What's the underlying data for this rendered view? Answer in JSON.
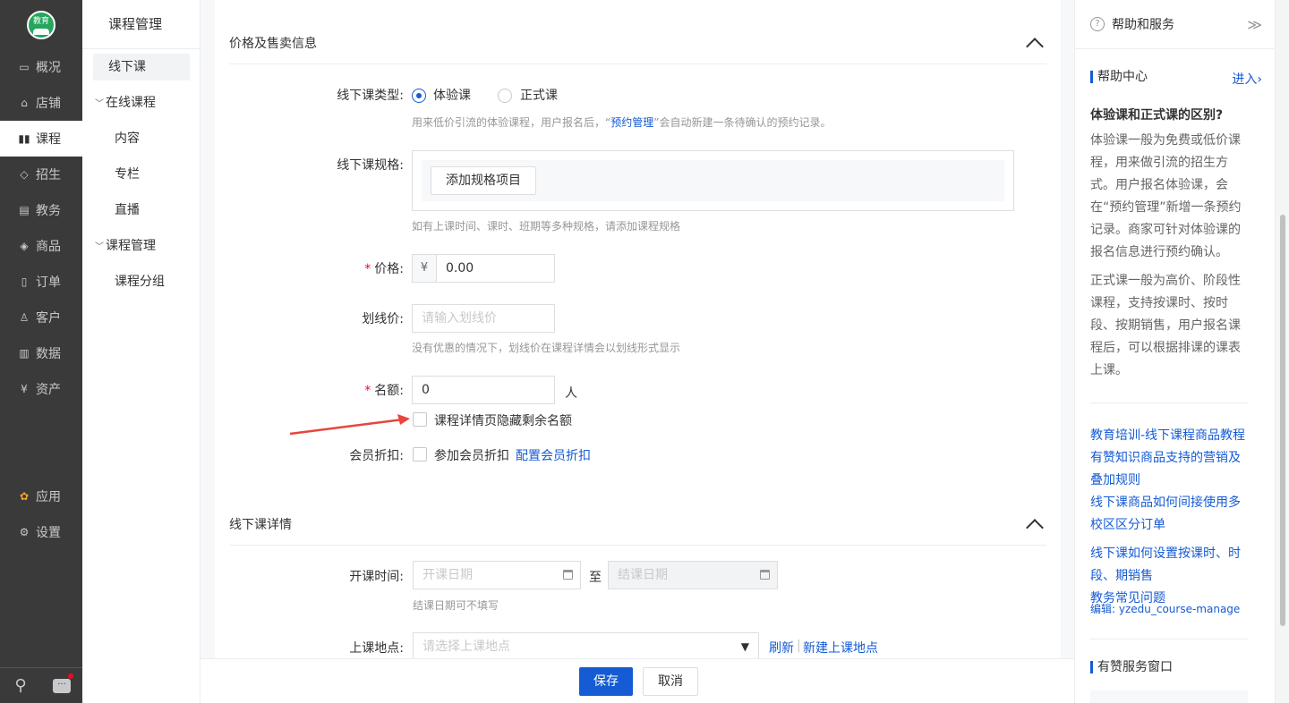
{
  "nav": {
    "logo_text": "教育",
    "items": [
      {
        "label": "概况",
        "icon": "monitor-icon"
      },
      {
        "label": "店铺",
        "icon": "store-icon"
      },
      {
        "label": "课程",
        "icon": "book-icon"
      },
      {
        "label": "招生",
        "icon": "graduation-cap-icon"
      },
      {
        "label": "教务",
        "icon": "calendar-icon"
      },
      {
        "label": "商品",
        "icon": "tag-icon"
      },
      {
        "label": "订单",
        "icon": "document-icon"
      },
      {
        "label": "客户",
        "icon": "user-icon"
      },
      {
        "label": "数据",
        "icon": "bar-chart-icon"
      },
      {
        "label": "资产",
        "icon": "yen-icon"
      },
      {
        "label": "应用",
        "icon": "apps-icon"
      },
      {
        "label": "设置",
        "icon": "gear-icon"
      }
    ],
    "active": "课程"
  },
  "subnav": {
    "title": "课程管理",
    "items": [
      {
        "label": "线下课"
      },
      {
        "label": "在线课程"
      },
      {
        "label": "内容"
      },
      {
        "label": "专栏"
      },
      {
        "label": "直播"
      },
      {
        "label": "课程管理"
      },
      {
        "label": "课程分组"
      }
    ]
  },
  "section1": {
    "title": "价格及售卖信息",
    "type_label": "线下课类型:",
    "type_options": [
      "体验课",
      "正式课"
    ],
    "type_selected": "体验课",
    "type_hint_pre": "用来低价引流的体验课程，用户报名后，“",
    "type_hint_link": "预约管理",
    "type_hint_post": "”会自动新建一条待确认的预约记录。",
    "spec_label": "线下课规格:",
    "spec_button": "添加规格项目",
    "spec_hint": "如有上课时间、课时、班期等多种规格，请添加课程规格",
    "price_label": "价格:",
    "price_currency": "¥",
    "price_value": "0.00",
    "strike_label": "划线价:",
    "strike_placeholder": "请输入划线价",
    "strike_hint": "没有优惠的情况下，划线价在课程详情会以划线形式显示",
    "quota_label": "名额:",
    "quota_value": "0",
    "quota_unit": "人",
    "hide_quota_label": "课程详情页隐藏剩余名额",
    "member_label": "会员折扣:",
    "member_checkbox": "参加会员折扣",
    "member_link": "配置会员折扣"
  },
  "section2": {
    "title": "线下课详情",
    "time_label": "开课时间:",
    "start_placeholder": "开课日期",
    "to": "至",
    "end_placeholder": "结课日期",
    "time_hint": "结课日期可不填写",
    "location_label": "上课地点:",
    "location_placeholder": "请选择上课地点",
    "refresh": "刷新",
    "separator": "|",
    "new_location": "新建上课地点"
  },
  "footer": {
    "save": "保存",
    "cancel": "取消"
  },
  "help": {
    "title": "帮助和服务",
    "center": "帮助中心",
    "enter": "进入",
    "question": "体验课和正式课的区别?",
    "p1": "体验课一般为免费或低价课程，用来做引流的招生方式。用户报名体验课，会在“预约管理”新增一条预约记录。商家可针对体验课的报名信息进行预约确认。",
    "p2": "正式课一般为高价、阶段性课程，支持按课时、按时段、按期销售，用户报名课程后，可以根据排课的课表上课。",
    "links": [
      "教育培训-线下课程商品教程",
      "有赞知识商品支持的营销及叠加规则",
      "线下课商品如何间接使用多校区区分订单",
      "线下课如何设置按课时、时段、期销售",
      "教务常见问题"
    ],
    "code_note": "编辑: yzedu_course-manage",
    "service": "有赞服务窗口"
  },
  "colors": {
    "accent": "#155bd4",
    "nav_bg": "#3a3a3b",
    "required": "#ee0a24",
    "arrow": "#e8453c"
  }
}
